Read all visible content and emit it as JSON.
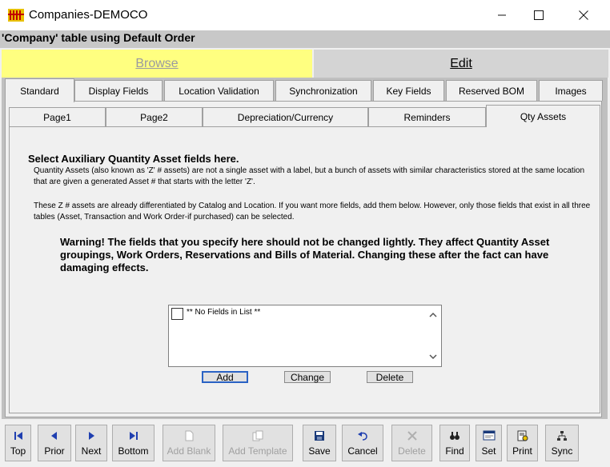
{
  "window": {
    "title": "Companies-DEMOCO"
  },
  "header": {
    "title": "'Company' table using Default Order"
  },
  "modes": {
    "browse": "Browse",
    "edit": "Edit"
  },
  "tabs_main": [
    "Standard",
    "Display Fields",
    "Location Validation",
    "Synchronization",
    "Key Fields",
    "Reserved BOM",
    "Images"
  ],
  "tabs_sub": [
    "Page1",
    "Page2",
    "Depreciation/Currency",
    "Reminders",
    "Qty Assets"
  ],
  "content": {
    "section_title": "Select Auxiliary Quantity Asset fields here.",
    "desc1": "Quantity Assets (also known as 'Z' # assets) are not a single asset with a label, but a bunch of assets with similar characteristics stored at the same location that are given a generated Asset # that starts with the letter 'Z'.",
    "desc2": "These Z # assets are already differentiated by Catalog and Location. If you want more fields, add them below. However, only those fields that exist in all three tables (Asset, Transaction and Work Order-if purchased) can be selected.",
    "warning": "Warning! The fields that you specify here should not be changed lightly. They affect Quantity Asset groupings, Work Orders, Reservations and Bills of Material. Changing these after the fact can have damaging effects.",
    "list_empty": "** No Fields in List **",
    "btn_add": "Add",
    "btn_change": "Change",
    "btn_delete": "Delete"
  },
  "toolbar": {
    "top": "Top",
    "prior": "Prior",
    "next": "Next",
    "bottom": "Bottom",
    "add_blank": "Add Blank",
    "add_template": "Add Template",
    "save": "Save",
    "cancel": "Cancel",
    "delete": "Delete",
    "find": "Find",
    "set": "Set",
    "print": "Print",
    "sync": "Sync"
  },
  "colors": {
    "browse_bg": "#ffff80",
    "nav_blue": "#1f3fb0",
    "focus_border": "#2a62c4"
  }
}
